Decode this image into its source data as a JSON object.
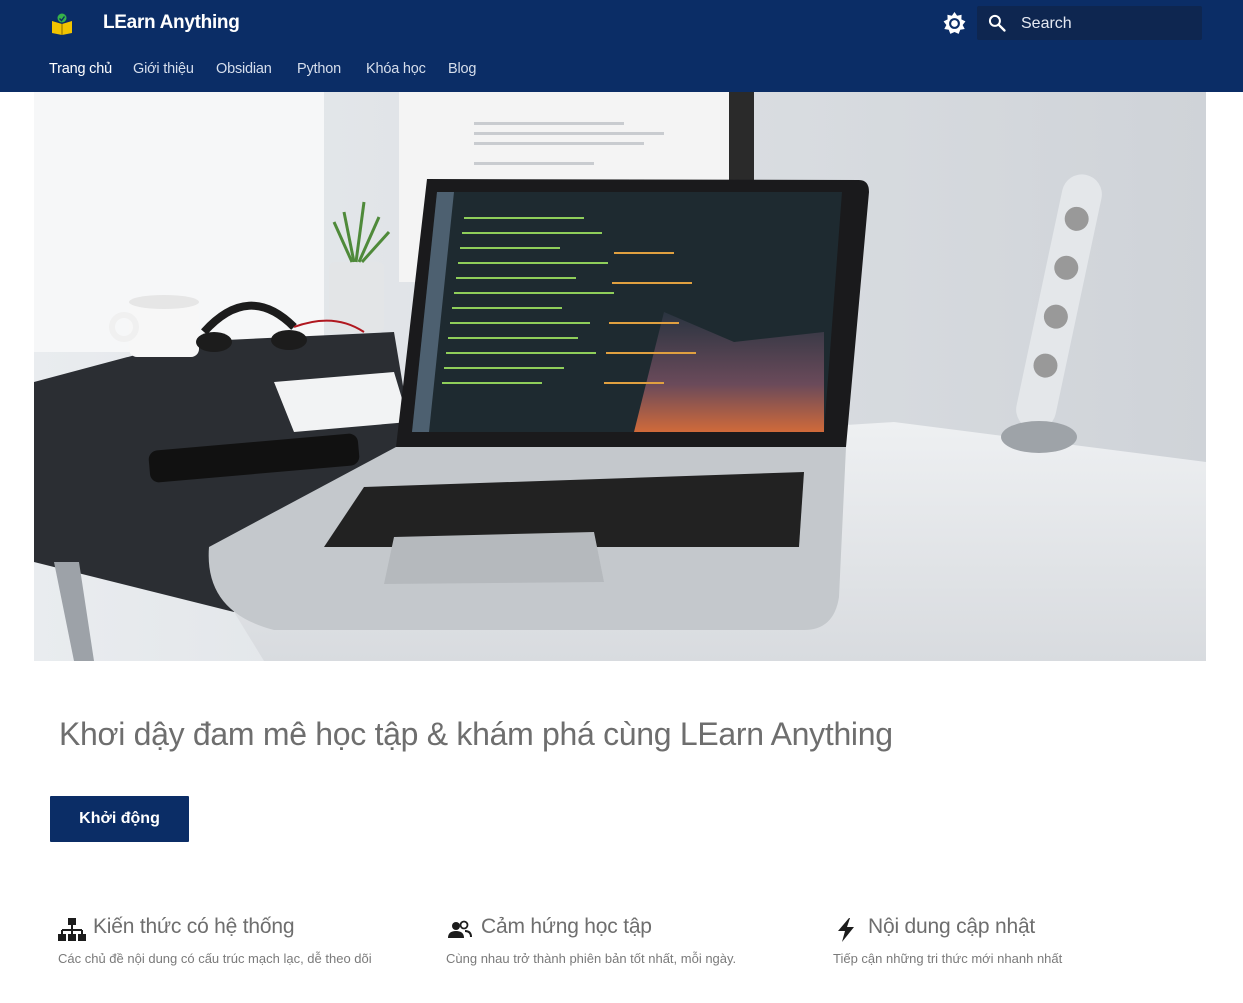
{
  "header": {
    "site_title": "LEarn Anything",
    "search_placeholder": "Search",
    "nav": [
      {
        "label": "Trang chủ",
        "active": true
      },
      {
        "label": "Giới thiệu",
        "active": false
      },
      {
        "label": "Obsidian",
        "active": false
      },
      {
        "label": "Python",
        "active": false
      },
      {
        "label": "Khóa học",
        "active": false
      },
      {
        "label": "Blog",
        "active": false
      }
    ]
  },
  "hero": {
    "image": "laptop-on-desk-with-code-editor"
  },
  "main": {
    "headline": "Khơi dậy đam mê học tập & khám phá cùng LEarn Anything",
    "cta_label": "Khởi động"
  },
  "features": [
    {
      "icon": "sitemap-icon",
      "title": "Kiến thức có hệ thống",
      "desc": "Các chủ đề nội dung có cấu trúc mạch lạc, dễ theo dõi"
    },
    {
      "icon": "users-icon",
      "title": "Cảm hứng học tập",
      "desc": "Cùng nhau trở thành phiên bản tốt nhất, mỗi ngày."
    },
    {
      "icon": "bolt-icon",
      "title": "Nội dung cập nhật",
      "desc": "Tiếp cận những tri thức mới nhanh nhất"
    }
  ],
  "colors": {
    "header_bg": "#0b2d66",
    "search_bg": "#0e2650",
    "button_bg": "#0b2d66",
    "headline_text": "#6e6e6e"
  }
}
